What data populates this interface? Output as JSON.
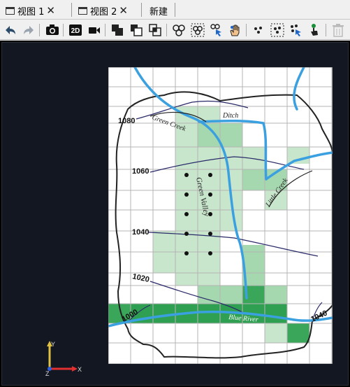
{
  "tabs": [
    {
      "label": "视图 1",
      "active": true
    },
    {
      "label": "视图 2",
      "active": false
    },
    {
      "label": "新建",
      "active": false
    }
  ],
  "toolbar": {
    "buttons": [
      "undo",
      "redo",
      "screenshot",
      "2D",
      "video",
      "union",
      "subtract",
      "intersect",
      "select-group",
      "select-group-box",
      "select-group-pointer",
      "pan-hand",
      "select-points",
      "select-points-box",
      "select-points-pointer",
      "select-point-finger",
      "delete"
    ],
    "view_2d_label": "2D"
  },
  "map": {
    "contours": [
      "1080",
      "1060",
      "1040",
      "1020",
      "1000",
      "1040"
    ],
    "labels": {
      "green_creek": "Green Creek",
      "ditch": "Ditch",
      "little_creek": "Little Creek",
      "green_valley": "Green Valley",
      "blue_river": "Blue River"
    }
  },
  "axes": {
    "x": "X",
    "y": "Y",
    "z": "Z"
  },
  "colors": {
    "viewport_bg": "#121722",
    "grid_cell": "#ffffff",
    "grid_line": "#b0b0b0",
    "light_green": "#c9e6cc",
    "mid_green": "#a4d8ae",
    "dark_green": "#3fa85f",
    "river": "#39a0e0"
  }
}
